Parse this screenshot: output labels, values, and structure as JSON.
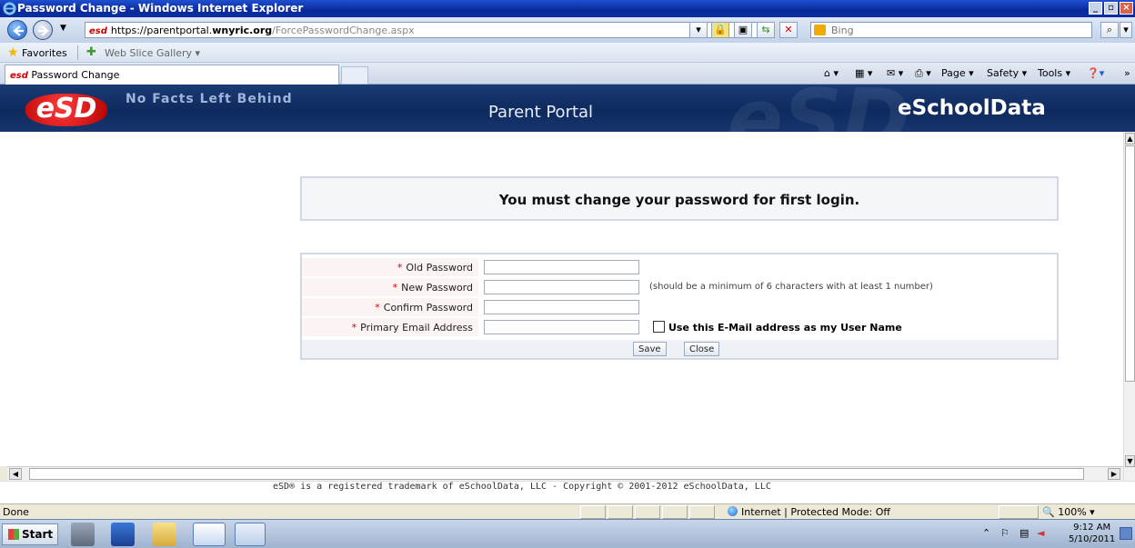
{
  "window": {
    "title": "Password Change - Windows Internet Explorer"
  },
  "address_bar": {
    "url_prefix": "https://parentportal.",
    "url_host": "wnyric.org",
    "url_path": "/ForcePasswordChange.aspx",
    "site_tag": "esd",
    "search_placeholder": "Bing"
  },
  "favorites_bar": {
    "favorites_label": "Favorites",
    "web_slice_label": "Web Slice Gallery ▾"
  },
  "tabs": [
    {
      "label": "Password Change"
    }
  ],
  "command_bar": {
    "page_label": "Page ▾",
    "safety_label": "Safety ▾",
    "tools_label": "Tools ▾"
  },
  "banner": {
    "logo_text": "eSD",
    "tagline": "No Facts Left Behind",
    "portal_title": "Parent Portal",
    "brand": "eSchoolData"
  },
  "message": {
    "text": "You must change your password for first login."
  },
  "form": {
    "required_mark": "*",
    "fields": [
      {
        "label": "Old Password",
        "value": ""
      },
      {
        "label": "New Password",
        "value": "",
        "hint": "(should be a minimum of 6 characters with at least 1 number)"
      },
      {
        "label": "Confirm Password",
        "value": ""
      },
      {
        "label": "Primary Email Address",
        "value": "",
        "checkbox_label": "Use this E-Mail address as my User Name",
        "checkbox_checked": false
      }
    ],
    "save_label": "Save",
    "close_label": "Close"
  },
  "footer": {
    "text": "eSD® is a registered trademark of eSchoolData, LLC - Copyright © 2001-2012 eSchoolData, LLC"
  },
  "status_bar": {
    "status_text": "Done",
    "zone_text": "Internet | Protected Mode: Off",
    "zoom": "100%"
  },
  "taskbar": {
    "start_label": "Start",
    "time": "9:12 AM",
    "date": "5/10/2011"
  },
  "colors": {
    "banner_bg": "#0e2a5e",
    "required": "#dd0000",
    "label_bg": "#fbf4f2"
  }
}
